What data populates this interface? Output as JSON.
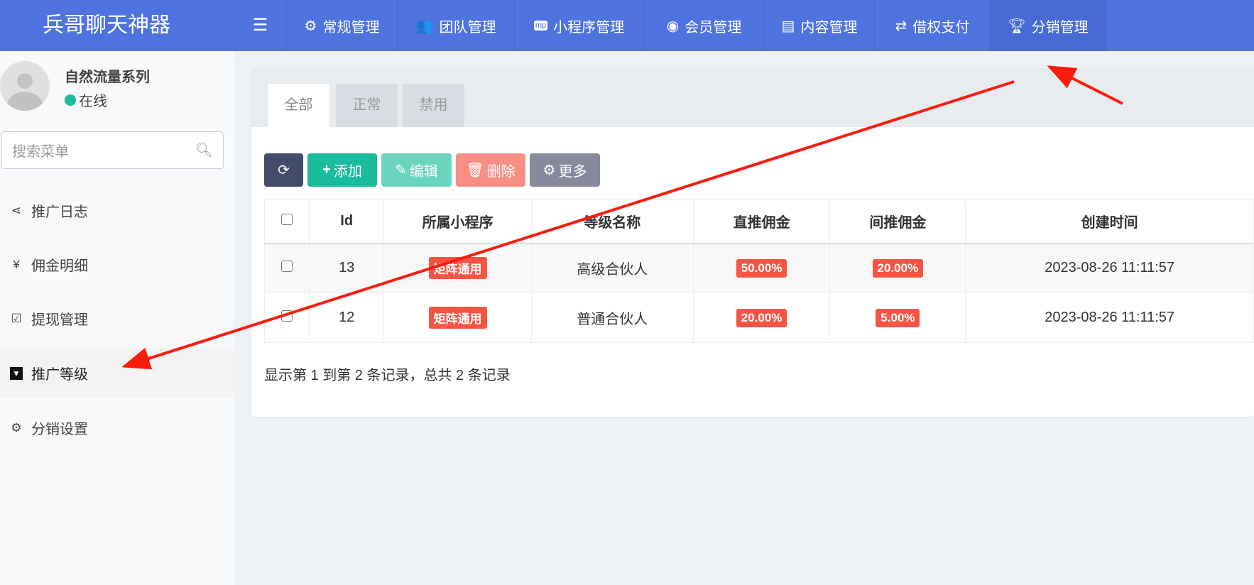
{
  "app_title": "兵哥聊天神器",
  "nav": {
    "items": [
      {
        "label": "常规管理",
        "icon": "cogs-icon"
      },
      {
        "label": "团队管理",
        "icon": "users-icon"
      },
      {
        "label": "小程序管理",
        "icon": "miniprogram-icon"
      },
      {
        "label": "会员管理",
        "icon": "user-circle-icon"
      },
      {
        "label": "内容管理",
        "icon": "newspaper-icon"
      },
      {
        "label": "借权支付",
        "icon": "exchange-icon"
      },
      {
        "label": "分销管理",
        "icon": "trophy-icon",
        "active": true
      }
    ]
  },
  "user": {
    "name": "自然流量系列",
    "status": "在线"
  },
  "search": {
    "placeholder": "搜索菜单"
  },
  "sidebar": {
    "items": [
      {
        "label": "推广日志",
        "icon": "share-icon"
      },
      {
        "label": "佣金明细",
        "icon": "yen-icon"
      },
      {
        "label": "提现管理",
        "icon": "check-square-icon"
      },
      {
        "label": "推广等级",
        "icon": "tie-icon",
        "active": true
      },
      {
        "label": "分销设置",
        "icon": "cogs-icon"
      }
    ]
  },
  "tabs": [
    "全部",
    "正常",
    "禁用"
  ],
  "toolbar": {
    "add": "添加",
    "edit": "编辑",
    "delete": "删除",
    "more": "更多"
  },
  "colors": {
    "nav": "#4e73df",
    "add": "#1abc9c",
    "edit": "#6bd4bf",
    "delete": "#f98e84",
    "more": "#868a9c",
    "refresh": "#444c6b",
    "label": "#f75444",
    "arrow": "#ff1a0e"
  },
  "table": {
    "headers": [
      "Id",
      "所属小程序",
      "等级名称",
      "直推佣金",
      "间推佣金",
      "创建时间"
    ],
    "rows": [
      {
        "id": "13",
        "app": "矩阵通用",
        "name": "高级合伙人",
        "direct": "50.00%",
        "indirect": "20.00%",
        "created": "2023-08-26 11:11:57"
      },
      {
        "id": "12",
        "app": "矩阵通用",
        "name": "普通合伙人",
        "direct": "20.00%",
        "indirect": "5.00%",
        "created": "2023-08-26 11:11:57"
      }
    ]
  },
  "footer": "显示第 1 到第 2 条记录，总共 2 条记录"
}
